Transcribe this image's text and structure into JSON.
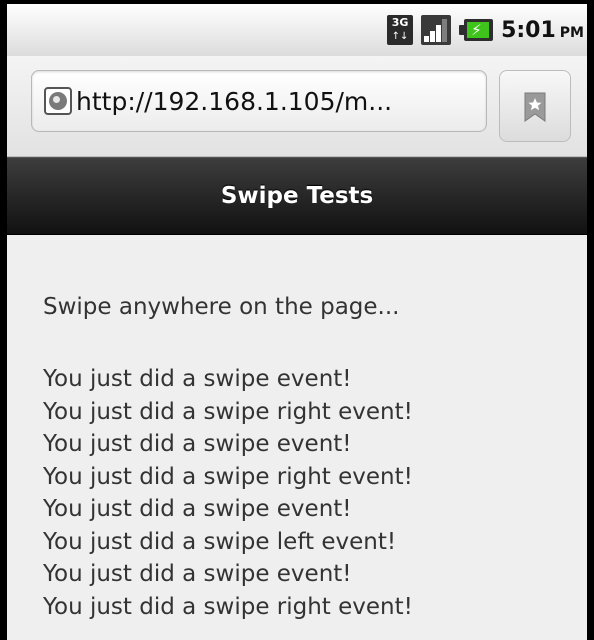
{
  "status_bar": {
    "network_label": "3G",
    "network_activity": "↑↓",
    "signal_level": 0.75,
    "battery_charging": true,
    "time": "5:01",
    "ampm": "PM"
  },
  "browser": {
    "url": "http://192.168.1.105/m..."
  },
  "page": {
    "title": "Swipe Tests",
    "instruction": "Swipe anywhere on the page...",
    "log": [
      "You just did a swipe event!",
      "You just did a swipe right event!",
      "You just did a swipe event!",
      "You just did a swipe right event!",
      "You just did a swipe event!",
      "You just did a swipe left event!",
      "You just did a swipe event!",
      "You just did a swipe right event!"
    ]
  },
  "colors": {
    "header_bg": "#1f1f1f",
    "content_bg": "#efefef",
    "text": "#333333",
    "battery_charge": "#3fc41c"
  }
}
